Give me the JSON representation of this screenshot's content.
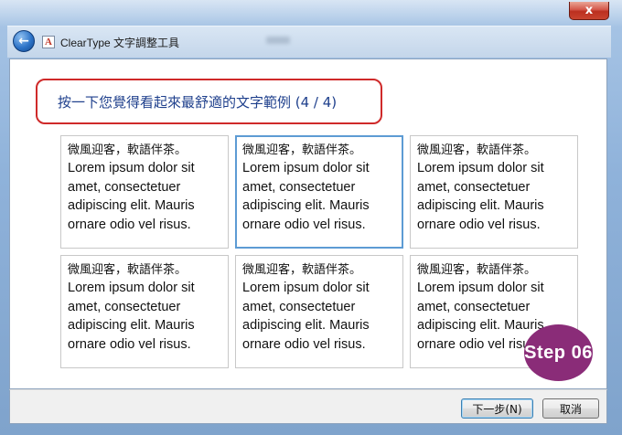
{
  "window": {
    "close_label": "x"
  },
  "titlebar": {
    "back_icon": "back-arrow-icon",
    "app_icon_text": "A",
    "title": "ClearType 文字調整工具"
  },
  "main": {
    "heading": "按一下您覺得看起來最舒適的文字範例 (4 / 4)",
    "samples": [
      {
        "cjk": "微風迎客，軟語伴茶。",
        "latin": "Lorem ipsum dolor sit amet, consectetuer adipiscing elit. Mauris ornare odio vel risus."
      },
      {
        "cjk": "微風迎客，軟語伴茶。",
        "latin": "Lorem ipsum dolor sit amet, consectetuer adipiscing elit. Mauris ornare odio vel risus."
      },
      {
        "cjk": "微風迎客，軟語伴茶。",
        "latin": "Lorem ipsum dolor sit amet, consectetuer adipiscing elit. Mauris ornare odio vel risus."
      },
      {
        "cjk": "微風迎客，軟語伴茶。",
        "latin": "Lorem ipsum dolor sit amet, consectetuer adipiscing elit. Mauris ornare odio vel risus."
      },
      {
        "cjk": "微風迎客，軟語伴茶。",
        "latin": "Lorem ipsum dolor sit amet, consectetuer adipiscing elit. Mauris ornare odio vel risus."
      },
      {
        "cjk": "微風迎客，軟語伴茶。",
        "latin": "Lorem ipsum dolor sit amet, consectetuer adipiscing elit. Mauris ornare odio vel risus."
      }
    ],
    "selected_index": 1
  },
  "footer": {
    "next_label": "下一步(N)",
    "cancel_label": "取消"
  },
  "overlay": {
    "step_badge": "Step 06"
  },
  "colors": {
    "heading_text": "#1e3f8c",
    "heading_border": "#cf2a2a",
    "selected_border": "#5d9bd4",
    "badge": "#8a2c78"
  }
}
